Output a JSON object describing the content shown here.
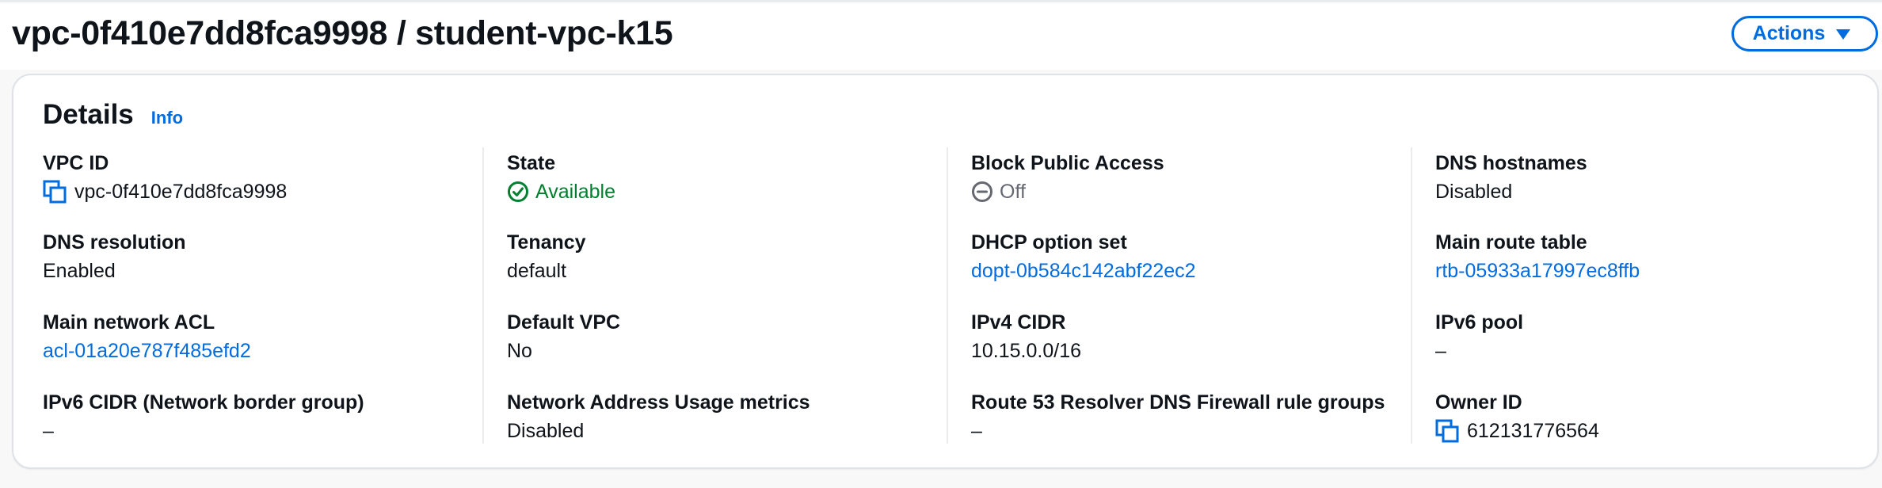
{
  "header": {
    "title": "vpc-0f410e7dd8fca9998 / student-vpc-k15",
    "actions_label": "Actions"
  },
  "details": {
    "title": "Details",
    "info_label": "Info",
    "fields": {
      "vpc_id": {
        "label": "VPC ID",
        "value": "vpc-0f410e7dd8fca9998",
        "icon": "copy-icon"
      },
      "state": {
        "label": "State",
        "value": "Available",
        "icon": "status-positive-icon",
        "color": "#00802f"
      },
      "block_public_access": {
        "label": "Block Public Access",
        "value": "Off",
        "icon": "status-stopped-icon",
        "color": "#656871"
      },
      "dns_hostnames": {
        "label": "DNS hostnames",
        "value": "Disabled"
      },
      "dns_resolution": {
        "label": "DNS resolution",
        "value": "Enabled"
      },
      "tenancy": {
        "label": "Tenancy",
        "value": "default"
      },
      "dhcp_option_set": {
        "label": "DHCP option set",
        "value": "dopt-0b584c142abf22ec2"
      },
      "main_route_table": {
        "label": "Main route table",
        "value": "rtb-05933a17997ec8ffb"
      },
      "main_network_acl": {
        "label": "Main network ACL",
        "value": "acl-01a20e787f485efd2"
      },
      "default_vpc": {
        "label": "Default VPC",
        "value": "No"
      },
      "ipv4_cidr": {
        "label": "IPv4 CIDR",
        "value": "10.15.0.0/16"
      },
      "ipv6_pool": {
        "label": "IPv6 pool",
        "value": "–"
      },
      "ipv6_cidr": {
        "label": "IPv6 CIDR (Network border group)",
        "value": "–"
      },
      "network_address_usage_metrics": {
        "label": "Network Address Usage metrics",
        "value": "Disabled"
      },
      "route53_resolver": {
        "label": "Route 53 Resolver DNS Firewall rule groups",
        "value": "–"
      },
      "owner_id": {
        "label": "Owner ID",
        "value": "612131776564",
        "icon": "copy-icon"
      }
    }
  },
  "colors": {
    "link": "#006ce0",
    "text": "#0f141a",
    "success": "#00802f",
    "muted": "#656871",
    "border": "#dfe2e6"
  }
}
